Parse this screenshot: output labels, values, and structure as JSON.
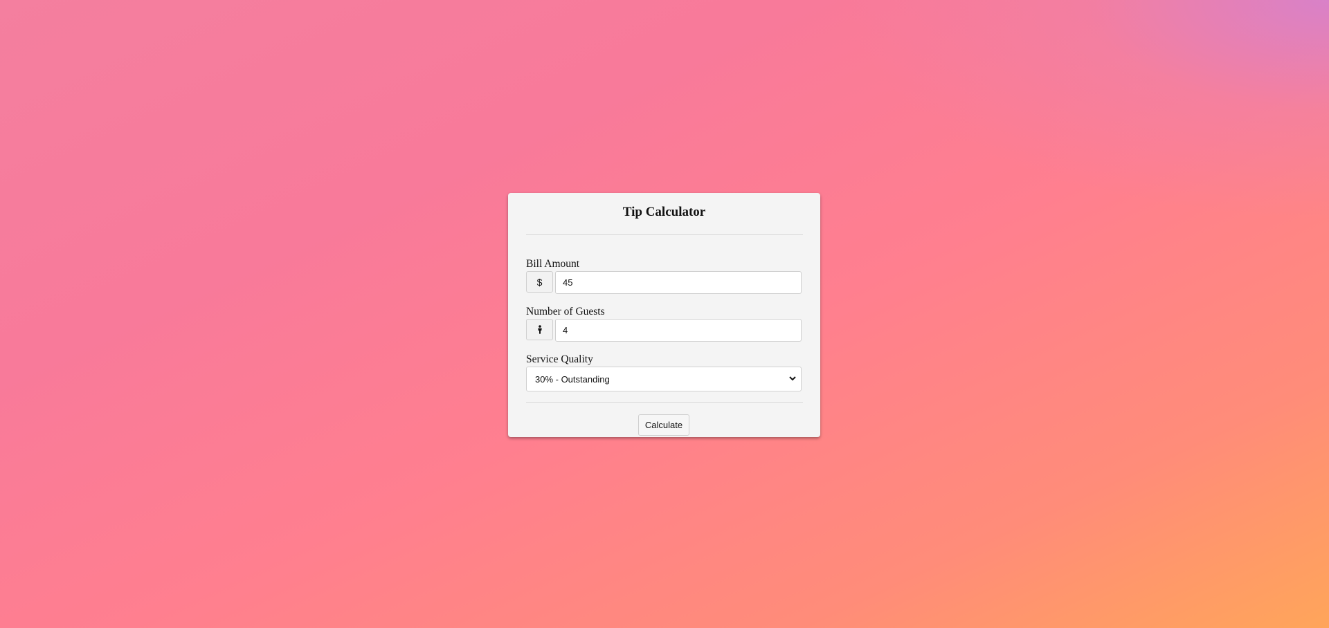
{
  "app": {
    "title": "Tip Calculator"
  },
  "form": {
    "bill": {
      "label": "Bill Amount",
      "addon_symbol": "$",
      "value": "45"
    },
    "guests": {
      "label": "Number of Guests",
      "addon_icon": "person-icon",
      "value": "4"
    },
    "service": {
      "label": "Service Quality",
      "selected": "30% - Outstanding"
    },
    "calculate_label": "Calculate"
  }
}
